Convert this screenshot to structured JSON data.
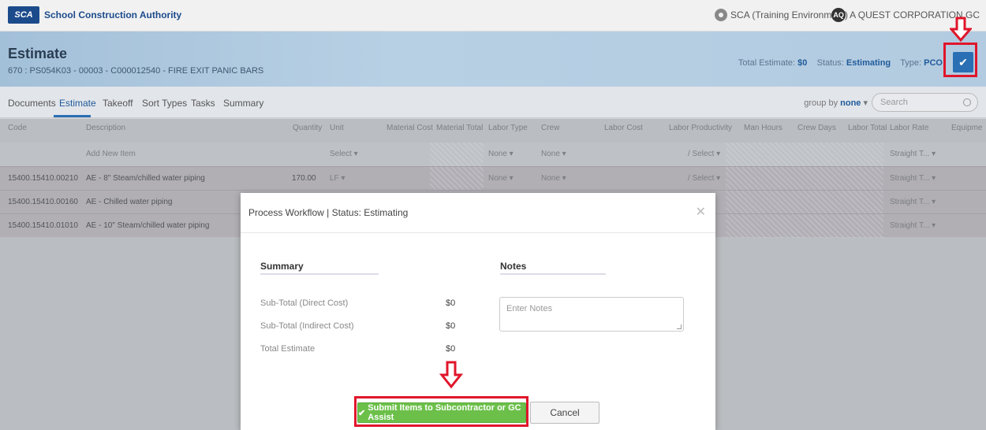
{
  "topbar": {
    "logo_short": "SCA",
    "logo_text": "School Construction Authority",
    "environment": "SCA (Training Environment)",
    "user_initials": "AQ",
    "user_name": "A QUEST CORPORATION GC"
  },
  "header": {
    "title": "Estimate",
    "subtitle": "670 : PS054K03 - 00003 - C000012540 - FIRE EXIT PANIC BARS",
    "total_label": "Total Estimate:",
    "total_value": "$0",
    "status_label": "Status:",
    "status_value": "Estimating",
    "type_label": "Type:",
    "type_value": "PCO",
    "action_icon": "check-icon"
  },
  "tabs": {
    "items": [
      "Documents",
      "Estimate",
      "Takeoff",
      "Sort Types",
      "Tasks",
      "Summary"
    ],
    "active": "Estimate",
    "group_by_label": "group by",
    "group_by_value": "none",
    "search_placeholder": "Search"
  },
  "table": {
    "columns": [
      "Code",
      "Description",
      "Quantity",
      "Unit",
      "Material Cost",
      "Material Total",
      "Labor Type",
      "Crew",
      "Labor Cost",
      "Labor Productivity",
      "Man Hours",
      "Crew Days",
      "Labor Total",
      "Labor Rate",
      "Equipme"
    ],
    "add_row": {
      "description": "Add New Item",
      "unit": "Select",
      "labor_type": "None",
      "crew": "None",
      "productivity": "/ Select",
      "labor_rate": "Straight T..."
    },
    "rows": [
      {
        "code": "15400.15410.00210",
        "description": "AE - 8\" Steam/chilled water piping",
        "quantity": "170.00",
        "unit": "LF",
        "labor_type": "None",
        "crew": "None",
        "productivity": "/ Select",
        "labor_rate": "Straight T..."
      },
      {
        "code": "15400.15410.00160",
        "description": "AE - Chilled water piping",
        "labor_rate": "Straight T..."
      },
      {
        "code": "15400.15410.01010",
        "description": "AE - 10\" Steam/chilled water piping",
        "labor_rate": "Straight T..."
      }
    ]
  },
  "modal": {
    "title": "Process Workflow | Status: Estimating",
    "summary_heading": "Summary",
    "notes_heading": "Notes",
    "summary_rows": [
      {
        "label": "Sub-Total (Direct Cost)",
        "value": "$0"
      },
      {
        "label": "Sub-Total (Indirect Cost)",
        "value": "$0"
      },
      {
        "label": "Total Estimate",
        "value": "$0"
      }
    ],
    "notes_placeholder": "Enter Notes",
    "submit_label": "Submit Items to Subcontractor or GC Assist",
    "cancel_label": "Cancel"
  },
  "colors": {
    "accent": "#2a6fb3",
    "submit_green": "#6cc04a",
    "annotation_red": "#e0162b"
  }
}
